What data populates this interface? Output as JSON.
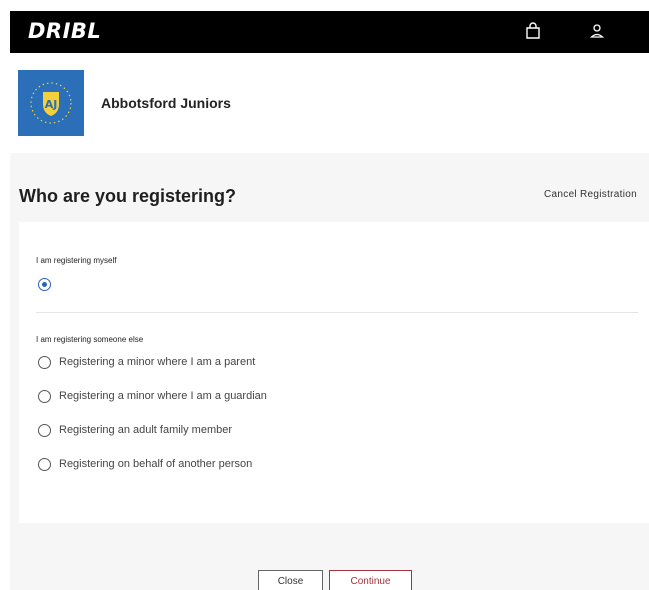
{
  "header": {
    "brand": "DRIBL",
    "icons": [
      "shopping-bag-icon",
      "user-icon"
    ],
    "background": "#000000"
  },
  "organisation": {
    "name": "Abbotsford Juniors",
    "logo_color": "#2a6fb8"
  },
  "registration": {
    "heading": "Who are you registering?",
    "cancel_label": "Cancel Registration",
    "self_section": {
      "label": "I am registering myself",
      "selected": true
    },
    "other_section": {
      "label": "I am registering someone else",
      "options": [
        {
          "label": "Registering a minor where I am a parent",
          "selected": false
        },
        {
          "label": "Registering a minor where I am a guardian",
          "selected": false
        },
        {
          "label": "Registering an adult family member",
          "selected": false
        },
        {
          "label": "Registering on behalf of another person",
          "selected": false
        }
      ]
    }
  },
  "actions": {
    "close_label": "Close",
    "continue_label": "Continue",
    "accent": "#a3333d"
  },
  "colors": {
    "radio_selected": "#2c61b5",
    "content_background": "#f6f6f6"
  }
}
